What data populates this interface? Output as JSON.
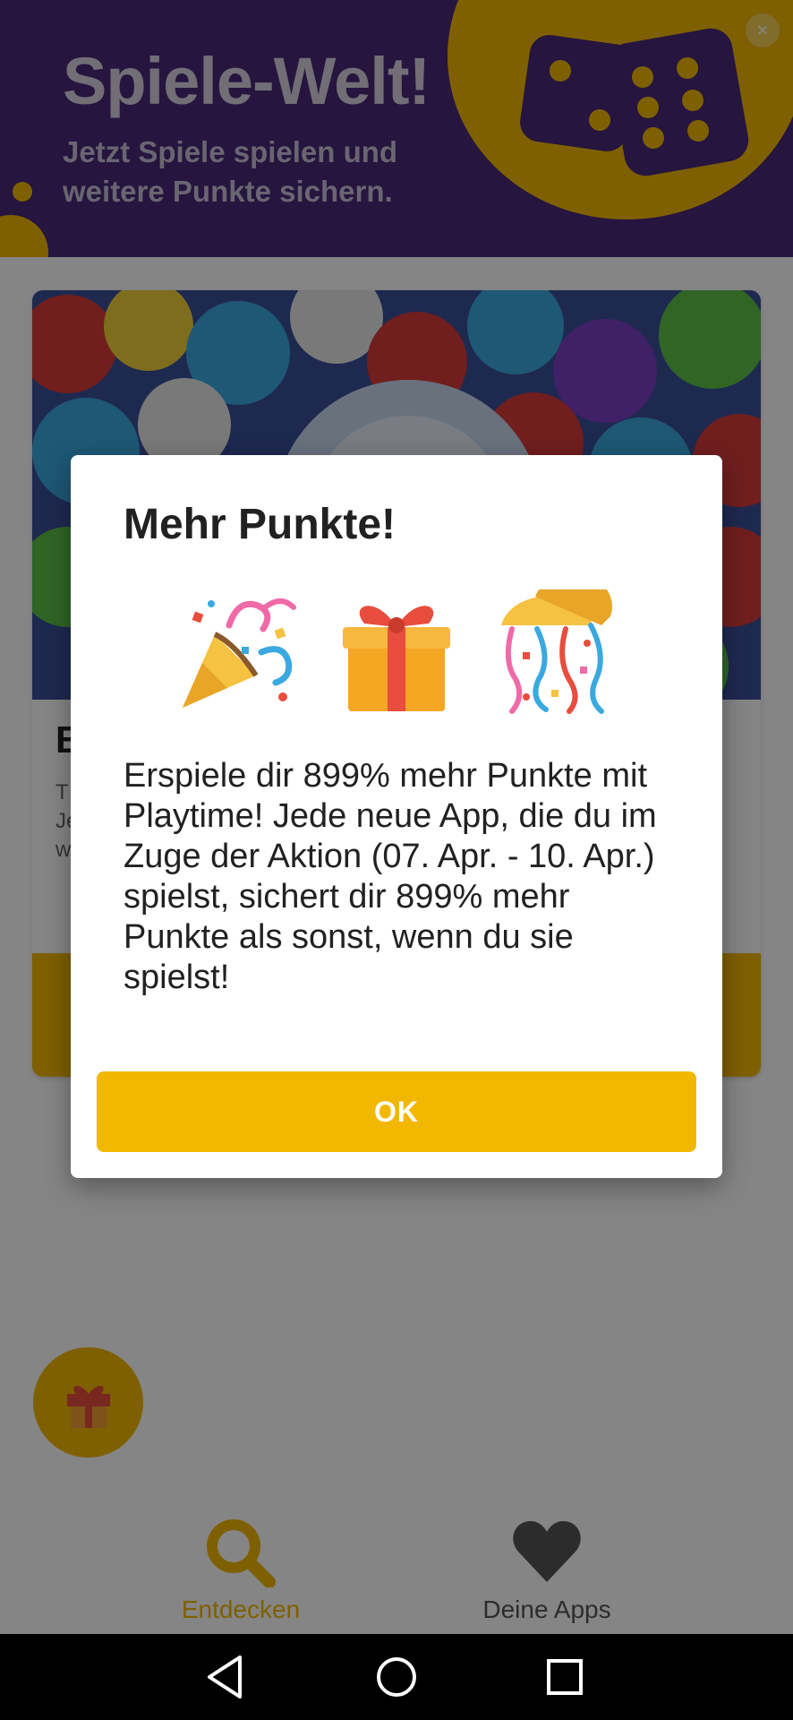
{
  "banner": {
    "title": "Spiele-Welt!",
    "subtitle": "Jetzt Spiele spielen und weitere Punkte sichern.",
    "close_label": "×",
    "icon": "dice-icon"
  },
  "card": {
    "title": "B",
    "text": "T\nJe\nw",
    "cta_label": ""
  },
  "fab": {
    "icon": "gift-icon"
  },
  "bottom_nav": {
    "items": [
      {
        "label": "Entdecken",
        "icon": "search-icon",
        "active": true
      },
      {
        "label": "Deine Apps",
        "icon": "heart-icon",
        "active": false
      }
    ]
  },
  "dialog": {
    "title": "Mehr Punkte!",
    "emojis": [
      "party-popper-icon",
      "wrapped-gift-icon",
      "confetti-ball-icon"
    ],
    "body": "Erspiele dir 899% mehr Punkte mit Playtime! Jede neue App, die du im Zuge der Aktion (07. Apr. - 10. Apr.) spielst, sichert dir 899% mehr Punkte als sonst, wenn du sie spielst!",
    "ok_label": "OK"
  },
  "system_nav": {
    "buttons": [
      "back-icon",
      "home-icon",
      "recents-icon"
    ]
  },
  "colors": {
    "accent": "#f2b800",
    "banner_bg": "#4a2a7a",
    "scrim": "rgba(0,0,0,0.48)",
    "text_primary": "#212121"
  }
}
